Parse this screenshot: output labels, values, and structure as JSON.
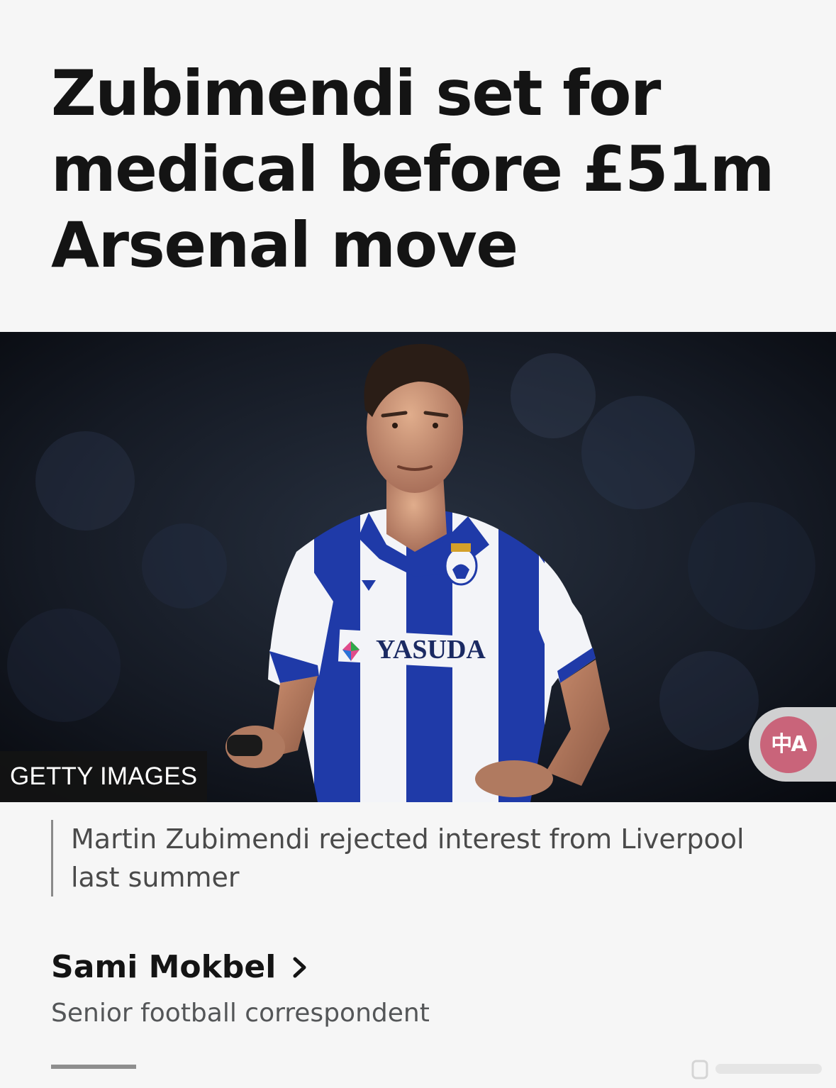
{
  "article": {
    "headline": "Zubimendi set for medical before £51m Arsenal move",
    "image_credit": "GETTY IMAGES",
    "image_caption": "Martin Zubimendi rejected interest from Liverpool last summer",
    "image_sponsor_text": "YASUDA",
    "author": {
      "name": "Sami Mokbel",
      "role": "Senior football correspondent"
    }
  },
  "translate_button": {
    "icon": "translate-icon",
    "glyph": "中A"
  },
  "colors": {
    "background": "#f6f6f6",
    "headline": "#141414",
    "caption": "#4a4a4a",
    "role": "#545658",
    "translate_accent": "#c9647a",
    "kit_blue": "#1f3aa8",
    "kit_white": "#f3f4f8"
  }
}
